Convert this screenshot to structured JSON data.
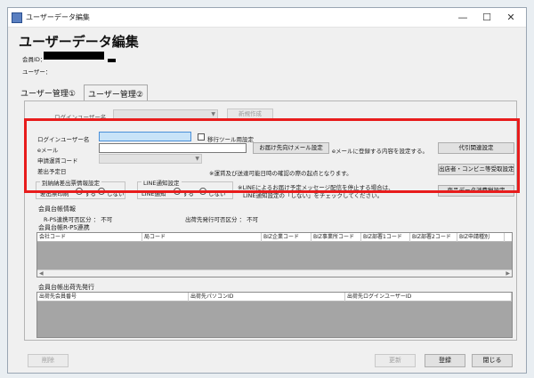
{
  "window": {
    "title": "ユーザーデータ編集",
    "min": "—",
    "max": "☐",
    "close": "✕"
  },
  "header": {
    "title": "ユーザーデータ編集",
    "member_id_label": "会員ID：",
    "user_label": "ユーザー："
  },
  "tabs": [
    {
      "label": "ユーザー管理①"
    },
    {
      "label": "ユーザー管理②"
    }
  ],
  "top_row": {
    "login_user_label": "ログインユーザー名",
    "new_create_button": "新規作成"
  },
  "form": {
    "login_user_label": "ログインユーザー名",
    "login_user_value": "",
    "tool_checkbox_label": "移行ツール用設定",
    "email_label": "eメール",
    "email_value": "",
    "delivery_mail_button": "お届け先向けメール設定",
    "email_note": "eメールに登録する内容を設定する。",
    "agency_button": "代引関連設定",
    "application_code_label": "申請運賃コード",
    "shipping_date_label": "差出予定日",
    "shipping_note": "※運賃及び送達可能日時の確認の際の起点となります。",
    "store_button": "出店者・コンビニ等受取設定",
    "separate_group_label": "別納納差出票情報設定",
    "print_label": "差出票印刷",
    "radio_yes": "する",
    "radio_no": "しない",
    "line_group_label": "LINE通知設定",
    "line_notify_label": "LINE通知",
    "line_note_1": "※LINEによるお届け予定メッセージ配信を停止する場合は、",
    "line_note_2": "LINE通知設定の「しない」をチェックしてください。",
    "product_button": "商品データ消費税設定"
  },
  "info": {
    "member_info_label": "会員台帳情報",
    "rps_label": "R-PS連携可否区分 ： 不可",
    "shipper_label": "出荷先発行可否区分 ： 不可",
    "rps_section_label": "会員台帳R-PS連携",
    "rps_columns": [
      "会社コード",
      "局コード",
      "BIZ企業コード",
      "BIZ事業所コード",
      "BIZ部署1コード",
      "BIZ部署2コード",
      "BIZ申請種別"
    ],
    "shipper_section_label": "会員台帳出荷先発行",
    "shipper_columns": [
      "出荷先会員番号",
      "出荷先パソコンID",
      "出荷先ログインユーザーID"
    ]
  },
  "footer": {
    "delete_button": "削除",
    "update_button": "更新",
    "register_button": "登録",
    "close_button": "閉じる"
  },
  "colors": {
    "highlight": "#e81c1c",
    "input_focus": "#c8e3f8"
  },
  "icons": {
    "app": "app-icon",
    "combo_arrow": "chevron-down-icon"
  }
}
